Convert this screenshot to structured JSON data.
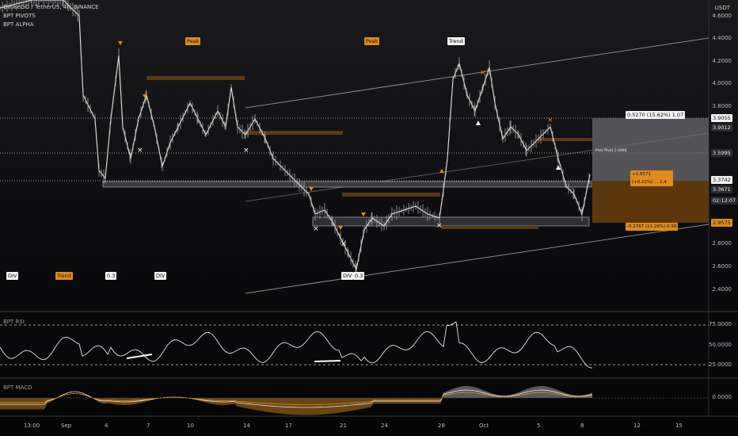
{
  "legend": {
    "symbol": "OmiseGO / TetherUS, 4h, BINANCE",
    "indicator_1": "BPT PIVOTS",
    "indicator_2": "BPT ALPHA"
  },
  "price_axis": {
    "currency": "USDT",
    "ticks": [
      "4.6000",
      "4.4000",
      "4.2000",
      "4.0000",
      "3.8000",
      "3.6000",
      "3.4000",
      "3.2000",
      "3.0000",
      "2.8000",
      "2.6000",
      "2.4000"
    ]
  },
  "price_labels": {
    "upper_band": "3.9055",
    "resistance": "3.9012",
    "pivot": "3.5995",
    "last": "3.3742",
    "support": "3.3671",
    "countdown": "02:12:07",
    "lower_band": "2.9575"
  },
  "trade_box": {
    "target_text": "0.5270 (15.62%) 1.07",
    "entry_text": "+0.8571 (+0.22%) ... 1.4",
    "stop_text": "-0.3767 (11.26%) 0.99",
    "mid_text": "Prev Pivot 3.5998"
  },
  "chart_tags": [
    {
      "text": "DIV",
      "style": "w"
    },
    {
      "text": "Trend",
      "style": "o"
    },
    {
      "text": "0.3",
      "style": "w"
    },
    {
      "text": "DIV",
      "style": "w"
    },
    {
      "text": "DIV",
      "style": "w"
    },
    {
      "text": "0.3",
      "style": "w"
    },
    {
      "text": "Trend",
      "style": "w"
    },
    {
      "text": "Peak",
      "style": "o"
    },
    {
      "text": "Peak",
      "style": "o"
    }
  ],
  "rsi": {
    "label": "BPT RSI",
    "ticks": [
      "75.0000",
      "50.0000",
      "25.0000"
    ]
  },
  "macd": {
    "label": "BPT MACD",
    "ticks": [
      "0.0000"
    ]
  },
  "time_axis": {
    "ticks": [
      "13:00",
      "Sep",
      "4",
      "7",
      "10",
      "14",
      "17",
      "21",
      "24",
      "28",
      "Oct",
      "5",
      "8",
      "12",
      "15"
    ]
  },
  "colors": {
    "accent": "#e08b1a",
    "candle": "#d9d9d9",
    "grid": "#2a2a2e"
  }
}
